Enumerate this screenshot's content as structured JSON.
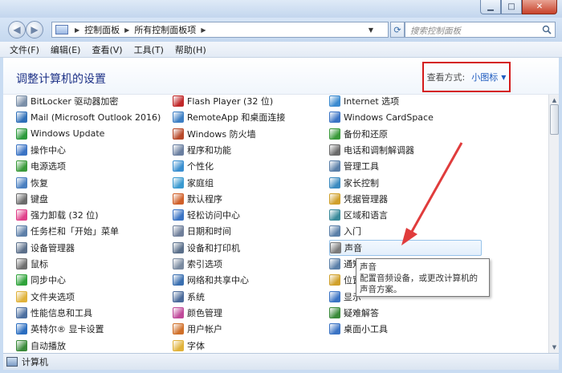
{
  "address": {
    "crumbs": [
      "控制面板",
      "所有控制面板项"
    ],
    "search_placeholder": "搜索控制面板"
  },
  "menu": [
    "文件(F)",
    "编辑(E)",
    "查看(V)",
    "工具(T)",
    "帮助(H)"
  ],
  "header": {
    "title": "调整计算机的设置",
    "view_by_label": "查看方式:",
    "view_by_value": "小图标"
  },
  "columns": [
    [
      {
        "label": "BitLocker 驱动器加密",
        "icon": "bitlocker-icon",
        "color": "#7a8fa8"
      },
      {
        "label": "Mail (Microsoft Outlook 2016)",
        "icon": "mail-icon",
        "color": "#2f6fb8"
      },
      {
        "label": "Windows Update",
        "icon": "windows-update-icon",
        "color": "#2c9a3c"
      },
      {
        "label": "操作中心",
        "icon": "action-center-flag-icon",
        "color": "#3a73c4"
      },
      {
        "label": "电源选项",
        "icon": "power-options-icon",
        "color": "#3a9a3a"
      },
      {
        "label": "恢复",
        "icon": "recovery-icon",
        "color": "#4a7fc0"
      },
      {
        "label": "键盘",
        "icon": "keyboard-icon",
        "color": "#6b6b6b"
      },
      {
        "label": "强力卸载 (32 位)",
        "icon": "uninstaller-icon",
        "color": "#e0408a"
      },
      {
        "label": "任务栏和「开始」菜单",
        "icon": "taskbar-icon",
        "color": "#5d7fa8"
      },
      {
        "label": "设备管理器",
        "icon": "device-manager-icon",
        "color": "#5b6f8a"
      },
      {
        "label": "鼠标",
        "icon": "mouse-icon",
        "color": "#6f6f6f"
      },
      {
        "label": "同步中心",
        "icon": "sync-center-icon",
        "color": "#2fa33a"
      },
      {
        "label": "文件夹选项",
        "icon": "folder-options-icon",
        "color": "#e0b23a"
      },
      {
        "label": "性能信息和工具",
        "icon": "performance-icon",
        "color": "#4c6fa0"
      },
      {
        "label": "英特尔® 显卡设置",
        "icon": "intel-graphics-icon",
        "color": "#2a6dc0"
      },
      {
        "label": "自动播放",
        "icon": "autoplay-icon",
        "color": "#3a8a3a"
      }
    ],
    [
      {
        "label": "Flash Player (32 位)",
        "icon": "flash-player-icon",
        "color": "#c0282a"
      },
      {
        "label": "RemoteApp 和桌面连接",
        "icon": "remoteapp-icon",
        "color": "#3d7fc4"
      },
      {
        "label": "Windows 防火墙",
        "icon": "firewall-icon",
        "color": "#b8492a"
      },
      {
        "label": "程序和功能",
        "icon": "programs-icon",
        "color": "#6a7fa0"
      },
      {
        "label": "个性化",
        "icon": "personalization-icon",
        "color": "#3a8fd0"
      },
      {
        "label": "家庭组",
        "icon": "homegroup-icon",
        "color": "#3a9ad0"
      },
      {
        "label": "默认程序",
        "icon": "default-programs-icon",
        "color": "#d0602a"
      },
      {
        "label": "轻松访问中心",
        "icon": "ease-of-access-icon",
        "color": "#3a73c4"
      },
      {
        "label": "日期和时间",
        "icon": "datetime-icon",
        "color": "#6f7f9a"
      },
      {
        "label": "设备和打印机",
        "icon": "devices-printers-icon",
        "color": "#5a6f8a"
      },
      {
        "label": "索引选项",
        "icon": "indexing-icon",
        "color": "#7a8aa0"
      },
      {
        "label": "网络和共享中心",
        "icon": "network-icon",
        "color": "#3a6fb0"
      },
      {
        "label": "系统",
        "icon": "system-icon",
        "color": "#4a6a9a"
      },
      {
        "label": "颜色管理",
        "icon": "color-management-icon",
        "color": "#c04a9a"
      },
      {
        "label": "用户帐户",
        "icon": "user-accounts-icon",
        "color": "#d0702a"
      },
      {
        "label": "字体",
        "icon": "fonts-icon",
        "color": "#e0b23a"
      }
    ],
    [
      {
        "label": "Internet 选项",
        "icon": "internet-options-icon",
        "color": "#3a8ad0"
      },
      {
        "label": "Windows CardSpace",
        "icon": "cardspace-icon",
        "color": "#3a73c4"
      },
      {
        "label": "备份和还原",
        "icon": "backup-icon",
        "color": "#3a9a3a"
      },
      {
        "label": "电话和调制解调器",
        "icon": "phone-modem-icon",
        "color": "#6a6a6a"
      },
      {
        "label": "管理工具",
        "icon": "admin-tools-icon",
        "color": "#5a7fa8"
      },
      {
        "label": "家长控制",
        "icon": "parental-controls-icon",
        "color": "#3a8ac0"
      },
      {
        "label": "凭据管理器",
        "icon": "credential-manager-icon",
        "color": "#d0a02a"
      },
      {
        "label": "区域和语言",
        "icon": "region-language-icon",
        "color": "#3a8a9a"
      },
      {
        "label": "入门",
        "icon": "getting-started-icon",
        "color": "#5a7fa8"
      },
      {
        "label": "声音",
        "icon": "speaker-icon",
        "color": "#7a7a7a"
      },
      {
        "label": "通知",
        "icon": "notification-icon",
        "color": "#5a7fa8"
      },
      {
        "label": "位置",
        "icon": "location-icon",
        "color": "#d0a02a"
      },
      {
        "label": "显示",
        "icon": "display-icon",
        "color": "#3a73c4"
      },
      {
        "label": "疑难解答",
        "icon": "troubleshooting-icon",
        "color": "#3a8a3a"
      },
      {
        "label": "桌面小工具",
        "icon": "gadgets-icon",
        "color": "#3a73c4"
      }
    ]
  ],
  "tooltip": {
    "title": "声音",
    "body": "配置音频设备，或更改计算机的声音方案。"
  },
  "status": {
    "text": "计算机"
  }
}
